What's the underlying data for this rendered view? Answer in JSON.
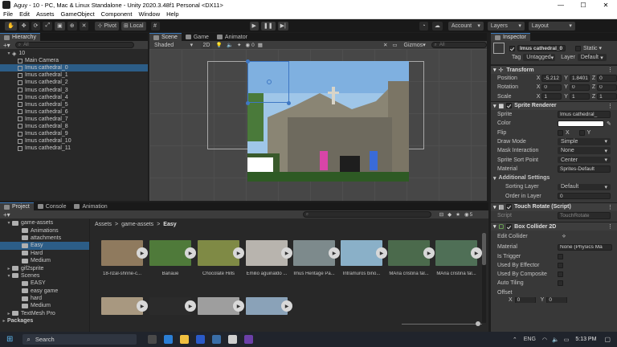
{
  "window": {
    "title": "Aguy - 10 - PC, Mac & Linux Standalone - Unity 2020.3.48f1 Personal <DX11>",
    "minimize": "—",
    "maximize": "☐",
    "close": "✕"
  },
  "menu": [
    "File",
    "Edit",
    "Assets",
    "GameObject",
    "Component",
    "Window",
    "Help"
  ],
  "toolbar": {
    "pivot": "Pivot",
    "local": "Local",
    "account": "Account",
    "layers": "Layers",
    "layout": "Layout"
  },
  "hierarchy": {
    "tab": "Hierarchy",
    "search_placeholder": "All",
    "scene": "10",
    "items": [
      "Main Camera",
      "Imus cathedral_0",
      "Imus cathedral_1",
      "Imus cathedral_2",
      "Imus cathedral_3",
      "Imus cathedral_4",
      "Imus cathedral_5",
      "Imus cathedral_6",
      "Imus cathedral_7",
      "Imus cathedral_8",
      "Imus cathedral_9",
      "Imus cathedral_10",
      "Imus cathedral_11"
    ],
    "selected_index": 1
  },
  "scene": {
    "tabs": [
      "Scene",
      "Game",
      "Animator"
    ],
    "shading": "Shaded",
    "mode_2d": "2D",
    "gizmos": "Gizmos",
    "search_placeholder": "All",
    "counter": "0"
  },
  "project": {
    "tabs": [
      "Project",
      "Console",
      "Animation"
    ],
    "tree": [
      {
        "label": "game-assets",
        "depth": 0,
        "arrow": "▾"
      },
      {
        "label": "Animations",
        "depth": 1,
        "arrow": ""
      },
      {
        "label": "attachments",
        "depth": 1,
        "arrow": ""
      },
      {
        "label": "Easy",
        "depth": 1,
        "arrow": "",
        "selected": true
      },
      {
        "label": "Hard",
        "depth": 1,
        "arrow": ""
      },
      {
        "label": "Medium",
        "depth": 1,
        "arrow": ""
      },
      {
        "label": "gif2sprite",
        "depth": 0,
        "arrow": "▸"
      },
      {
        "label": "Scenes",
        "depth": 0,
        "arrow": "▾"
      },
      {
        "label": "EASY",
        "depth": 1,
        "arrow": ""
      },
      {
        "label": "easy game",
        "depth": 1,
        "arrow": ""
      },
      {
        "label": "hard",
        "depth": 1,
        "arrow": ""
      },
      {
        "label": "Medium",
        "depth": 1,
        "arrow": ""
      },
      {
        "label": "TextMesh Pro",
        "depth": 0,
        "arrow": "▸"
      },
      {
        "label": "Packages",
        "depth": -1,
        "arrow": "▸"
      }
    ],
    "breadcrumb": [
      "Assets",
      "game-assets",
      "Easy"
    ],
    "breadcrumb_sep": ">",
    "hidden_count": "5",
    "assets": [
      {
        "caption": "18-rizal-shrine-c...",
        "color": "#8f7a5e"
      },
      {
        "caption": "Banaue",
        "color": "#4f7a3a"
      },
      {
        "caption": "Chocolate Hills",
        "color": "#7f8a45"
      },
      {
        "caption": "Emilio aguinaldo ...",
        "color": "#b8b4ae"
      },
      {
        "caption": "Imus Heritage Pa...",
        "color": "#7d8a8c"
      },
      {
        "caption": "Intramuros bino...",
        "color": "#8ab0c8"
      },
      {
        "caption": "MAria cristina fal...",
        "color": "#4b6a4c"
      },
      {
        "caption": "MAria cristina fal...",
        "color": "#4f6f56"
      }
    ],
    "assets_row2": [
      "#a89880",
      "#2b2b2b",
      "#9e9e9e",
      "#8aa2b8"
    ]
  },
  "inspector": {
    "tab": "Inspector",
    "object_name": "Imus cathedral_0",
    "static_label": "Static",
    "tag_label": "Tag",
    "tag": "Untagged",
    "layer_label": "Layer",
    "layer": "Default",
    "transform": {
      "title": "Transform",
      "rows": [
        {
          "label": "Position",
          "x": "-5.212",
          "y": "1.8401",
          "z": "0"
        },
        {
          "label": "Rotation",
          "x": "0",
          "y": "0",
          "z": "0"
        },
        {
          "label": "Scale",
          "x": "1",
          "y": "1",
          "z": "1"
        }
      ]
    },
    "sprite_renderer": {
      "title": "Sprite Renderer",
      "sprite_label": "Sprite",
      "sprite": "Imus cathedral_",
      "color_label": "Color",
      "flip_label": "Flip",
      "flip_x": "X",
      "flip_y": "Y",
      "draw_mode_label": "Draw Mode",
      "draw_mode": "Simple",
      "mask_label": "Mask Interaction",
      "mask": "None",
      "sort_point_label": "Sprite Sort Point",
      "sort_point": "Center",
      "material_label": "Material",
      "material": "Sprites-Default",
      "additional_label": "Additional Settings",
      "sorting_layer_label": "Sorting Layer",
      "sorting_layer": "Default",
      "order_label": "Order in Layer",
      "order": "0"
    },
    "touch_rotate": {
      "title": "Touch Rotate (Script)",
      "script_label": "Script",
      "script": "TouchRotate"
    },
    "box_collider": {
      "title": "Box Collider 2D",
      "edit_label": "Edit Collider",
      "material_label": "Material",
      "material": "None (Physics Ma",
      "trigger_label": "Is Trigger",
      "effector_label": "Used By Effector",
      "composite_label": "Used By Composite",
      "autotiling_label": "Auto Tiling",
      "offset_label": "Offset",
      "offset_x": "0",
      "offset_y": "0"
    }
  },
  "taskbar": {
    "search": "Search",
    "lang": "ENG",
    "time": "5:13 PM"
  }
}
